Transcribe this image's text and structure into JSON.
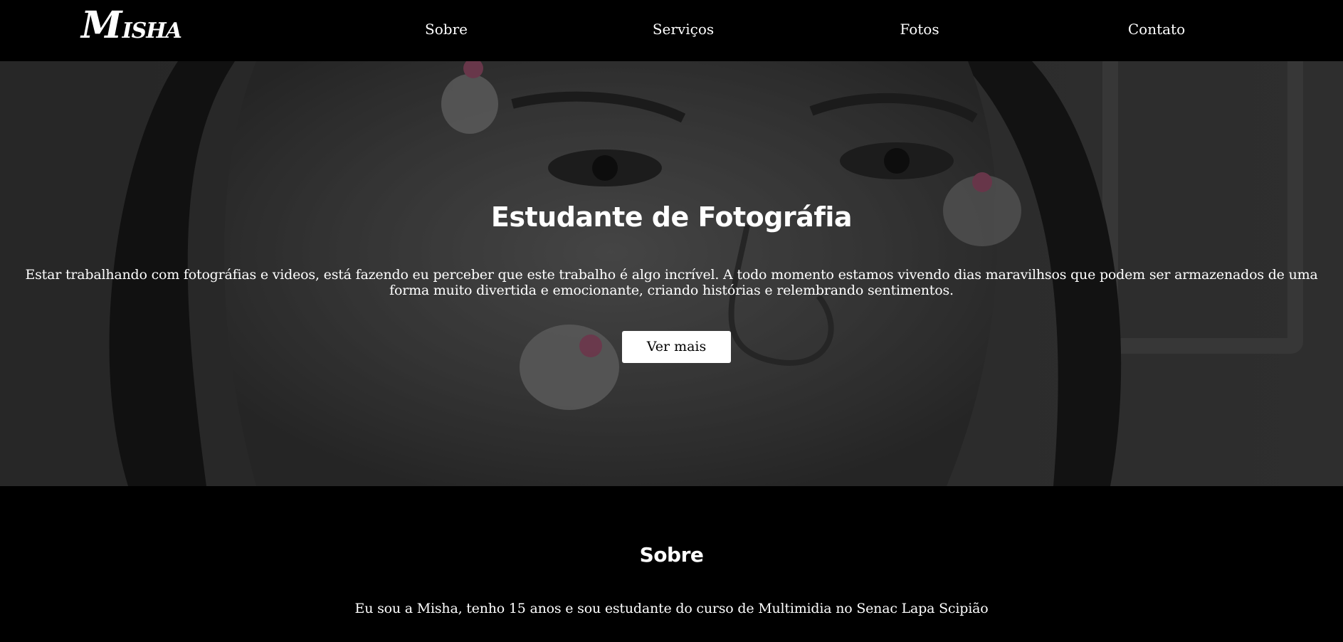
{
  "navbar": {
    "logo": {
      "initial": "M",
      "rest": "ISHA"
    },
    "links": [
      {
        "label": "Sobre"
      },
      {
        "label": "Serviços"
      },
      {
        "label": "Fotos"
      },
      {
        "label": "Contato"
      }
    ]
  },
  "hero": {
    "title": "Estudante de Fotográfia",
    "text": "Estar trabalhando com fotográfias e videos, está fazendo eu perceber que este trabalho é algo incrível. A todo momento estamos vivendo dias maravilhsos que podem ser armazenados de uma forma muito divertida e emocionante, criando histórias e relembrando sentimentos.",
    "button_label": "Ver mais"
  },
  "about": {
    "title": "Sobre",
    "text": "Eu sou a Misha, tenho 15 anos e sou estudante do curso de Multimidia no Senac Lapa Scipião"
  },
  "colors": {
    "background": "#000000",
    "text": "#ffffff",
    "button_bg": "#ffffff",
    "button_text": "#000000"
  }
}
